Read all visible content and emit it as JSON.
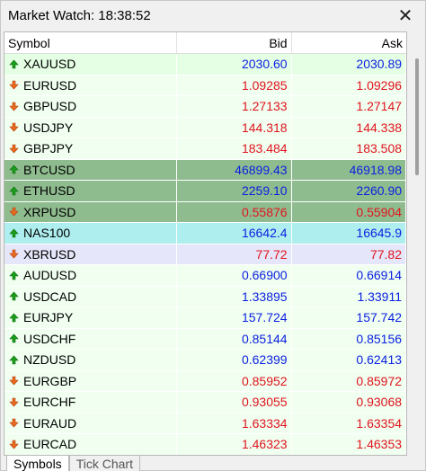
{
  "window": {
    "title": "Market Watch: 18:38:52",
    "close_label": "✕"
  },
  "table": {
    "headers": {
      "symbol": "Symbol",
      "bid": "Bid",
      "ask": "Ask"
    },
    "rows": [
      {
        "symbol": "XAUUSD",
        "bid": "2030.60",
        "ask": "2030.89",
        "direction": "up",
        "bg": "#e4ffe4"
      },
      {
        "symbol": "EURUSD",
        "bid": "1.09285",
        "ask": "1.09296",
        "direction": "down",
        "bg": "#f0fff0"
      },
      {
        "symbol": "GBPUSD",
        "bid": "1.27133",
        "ask": "1.27147",
        "direction": "down",
        "bg": "#f0fff0"
      },
      {
        "symbol": "USDJPY",
        "bid": "144.318",
        "ask": "144.338",
        "direction": "down",
        "bg": "#f0fff0"
      },
      {
        "symbol": "GBPJPY",
        "bid": "183.484",
        "ask": "183.508",
        "direction": "down",
        "bg": "#f0fff0"
      },
      {
        "symbol": "BTCUSD",
        "bid": "46899.43",
        "ask": "46918.98",
        "direction": "up",
        "bg": "#8fbc8f"
      },
      {
        "symbol": "ETHUSD",
        "bid": "2259.10",
        "ask": "2260.90",
        "direction": "up",
        "bg": "#8fbc8f"
      },
      {
        "symbol": "XRPUSD",
        "bid": "0.55876",
        "ask": "0.55904",
        "direction": "down",
        "bg": "#8fbc8f"
      },
      {
        "symbol": "NAS100",
        "bid": "16642.4",
        "ask": "16645.9",
        "direction": "up",
        "bg": "#aeeeee"
      },
      {
        "symbol": "XBRUSD",
        "bid": "77.72",
        "ask": "77.82",
        "direction": "down",
        "bg": "#e6e6fa"
      },
      {
        "symbol": "AUDUSD",
        "bid": "0.66900",
        "ask": "0.66914",
        "direction": "up",
        "bg": "#f0fff0"
      },
      {
        "symbol": "USDCAD",
        "bid": "1.33895",
        "ask": "1.33911",
        "direction": "up",
        "bg": "#f0fff0"
      },
      {
        "symbol": "EURJPY",
        "bid": "157.724",
        "ask": "157.742",
        "direction": "up",
        "bg": "#f0fff0"
      },
      {
        "symbol": "USDCHF",
        "bid": "0.85144",
        "ask": "0.85156",
        "direction": "up",
        "bg": "#f0fff0"
      },
      {
        "symbol": "NZDUSD",
        "bid": "0.62399",
        "ask": "0.62413",
        "direction": "up",
        "bg": "#f0fff0"
      },
      {
        "symbol": "EURGBP",
        "bid": "0.85952",
        "ask": "0.85972",
        "direction": "down",
        "bg": "#f0fff0"
      },
      {
        "symbol": "EURCHF",
        "bid": "0.93055",
        "ask": "0.93068",
        "direction": "down",
        "bg": "#f0fff0"
      },
      {
        "symbol": "EURAUD",
        "bid": "1.63334",
        "ask": "1.63354",
        "direction": "down",
        "bg": "#f0fff0"
      },
      {
        "symbol": "EURCAD",
        "bid": "1.46323",
        "ask": "1.46353",
        "direction": "down",
        "bg": "#f0fff0"
      }
    ]
  },
  "tabs": [
    {
      "label": "Symbols",
      "active": true
    },
    {
      "label": "Tick Chart",
      "active": false
    }
  ],
  "colors": {
    "up_price": "#0b1fe0",
    "down_price": "#e0141e",
    "up_arrow": "#1a9e1a",
    "down_arrow": "#e0461e"
  },
  "icons": {
    "up": "arrow-up-icon",
    "down": "arrow-down-icon"
  }
}
